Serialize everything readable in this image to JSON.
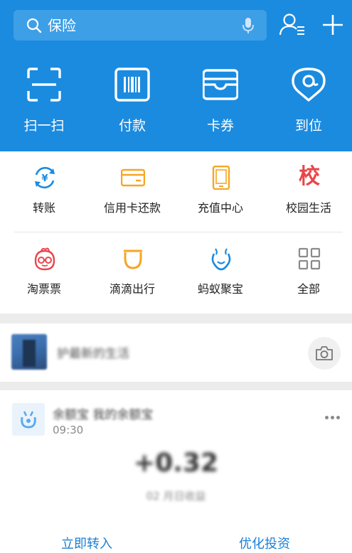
{
  "header": {
    "search_placeholder": "保险",
    "colors": {
      "bg": "#1b8bdf",
      "search_bg": "#3d9fe6"
    },
    "icons": [
      "search-icon",
      "microphone-icon",
      "contacts-icon",
      "plus-icon"
    ],
    "quick_actions": [
      {
        "label": "扫一扫",
        "icon": "scan-icon"
      },
      {
        "label": "付款",
        "icon": "barcode-icon"
      },
      {
        "label": "卡券",
        "icon": "wallet-icon"
      },
      {
        "label": "到位",
        "icon": "location-icon"
      }
    ]
  },
  "services": [
    {
      "label": "转账",
      "icon": "transfer-icon"
    },
    {
      "label": "信用卡还款",
      "icon": "credit-card-icon"
    },
    {
      "label": "充值中心",
      "icon": "phone-icon"
    },
    {
      "label": "校园生活",
      "icon": "school-icon",
      "glyph": "校"
    },
    {
      "label": "淘票票",
      "icon": "ticket-mascot-icon"
    },
    {
      "label": "滴滴出行",
      "icon": "didi-icon"
    },
    {
      "label": "蚂蚁聚宝",
      "icon": "ant-fortune-icon"
    },
    {
      "label": "全部",
      "icon": "grid-icon"
    }
  ],
  "feed": {
    "message_card": {
      "text": "护最新的生活"
    },
    "yuebao_card": {
      "title": "余额宝 我的余额宝",
      "time": "09:30",
      "amount": "+0.32",
      "subtitle": "02 月日收益",
      "actions": [
        "立即转入",
        "优化投资"
      ]
    }
  }
}
